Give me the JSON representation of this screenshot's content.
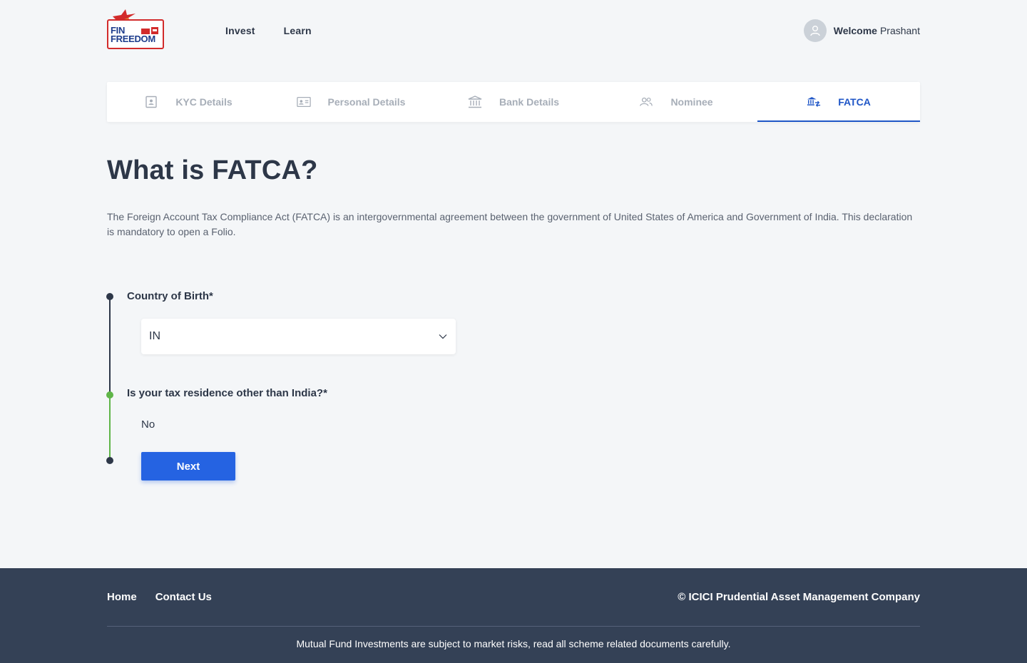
{
  "header": {
    "logo_text_line1": "FIN",
    "logo_text_line2": "FREEDOM",
    "nav": [
      {
        "label": "Invest"
      },
      {
        "label": "Learn"
      }
    ],
    "welcome_label": "Welcome",
    "user_name": "Prashant"
  },
  "tabs": [
    {
      "label": "KYC Details",
      "icon": "id-card-icon",
      "active": false
    },
    {
      "label": "Personal Details",
      "icon": "contact-card-icon",
      "active": false
    },
    {
      "label": "Bank Details",
      "icon": "bank-icon",
      "active": false
    },
    {
      "label": "Nominee",
      "icon": "people-icon",
      "active": false
    },
    {
      "label": "FATCA",
      "icon": "bank-transfer-icon",
      "active": true
    }
  ],
  "colors": {
    "accent": "#1f56c7",
    "button": "#2563e2",
    "progress_done": "#5fb548",
    "footer_bg": "#344156"
  },
  "main": {
    "title": "What is FATCA?",
    "description": "The Foreign Account Tax Compliance Act (FATCA) is an intergovernmental agreement between the government of United States of America and Government of India. This declaration is mandatory to open a Folio."
  },
  "form": {
    "country_label": "Country of Birth*",
    "country_value": "IN",
    "tax_label": "Is your tax residence other than India?*",
    "tax_value": "No",
    "next_label": "Next"
  },
  "footer": {
    "links": [
      {
        "label": "Home"
      },
      {
        "label": "Contact Us"
      }
    ],
    "copyright": "© ICICI Prudential Asset Management Company",
    "disclaimer": "Mutual Fund Investments are subject to market risks, read all scheme related documents carefully."
  }
}
